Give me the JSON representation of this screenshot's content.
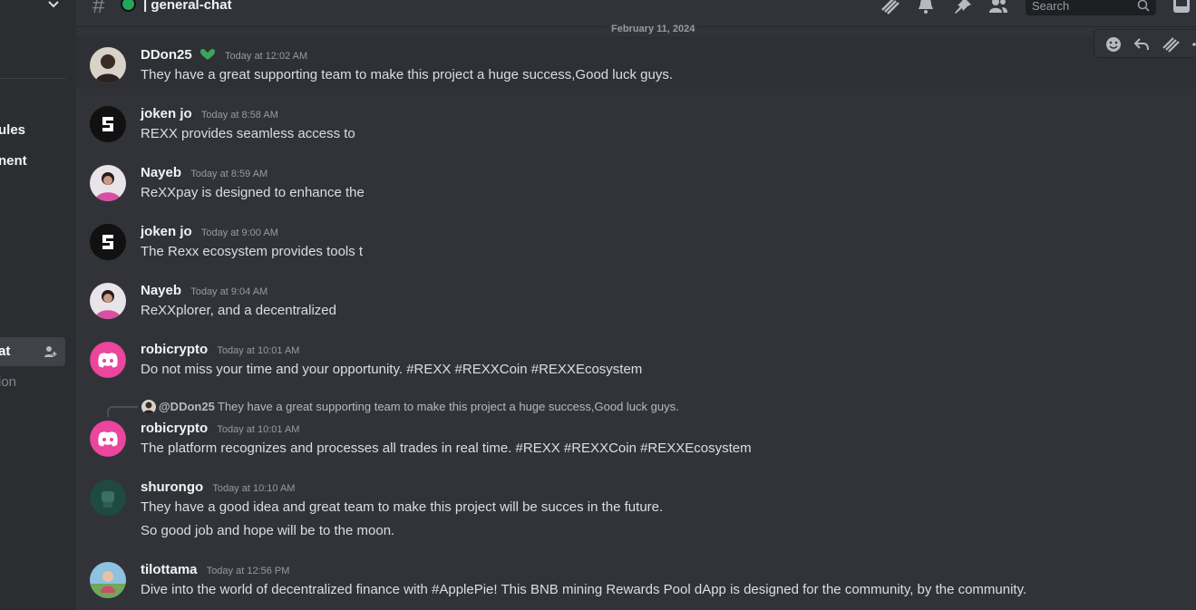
{
  "sidebar": {
    "channels": [
      {
        "label": "ules"
      },
      {
        "label": "nent"
      }
    ],
    "active_channel": {
      "label": "at"
    },
    "dim_channel": {
      "label": "ion"
    }
  },
  "topbar": {
    "channel_name": "| general-chat",
    "search_placeholder": "Search"
  },
  "date_separator": "February 11, 2024",
  "messages": [
    {
      "author": "DDon25",
      "timestamp": "Today at 12:02 AM",
      "lines": [
        "They have a great supporting team to make this project a huge success,Good luck guys."
      ]
    },
    {
      "author": "joken  jo",
      "timestamp": "Today at 8:58 AM",
      "lines": [
        "REXX provides seamless access to"
      ]
    },
    {
      "author": "Nayeb",
      "timestamp": "Today at 8:59 AM",
      "lines": [
        "ReXXpay is designed to enhance the"
      ]
    },
    {
      "author": "joken  jo",
      "timestamp": "Today at 9:00 AM",
      "lines": [
        "The Rexx ecosystem provides tools t"
      ]
    },
    {
      "author": "Nayeb",
      "timestamp": "Today at 9:04 AM",
      "lines": [
        "ReXXplorer, and a decentralized"
      ]
    },
    {
      "author": "robicrypto",
      "timestamp": "Today at 10:01 AM",
      "lines": [
        "Do not miss your time and your opportunity. #REXX #REXXCoin #REXXEcosystem"
      ]
    },
    {
      "author": "robicrypto",
      "timestamp": "Today at 10:01 AM",
      "lines": [
        "The platform recognizes and processes all trades in real time. #REXX #REXXCoin #REXXEcosystem"
      ],
      "reply": {
        "author": "@DDon25",
        "text": "They have a great supporting team to make this project a huge success,Good luck guys."
      }
    },
    {
      "author": "shurongo",
      "timestamp": "Today at 10:10 AM",
      "lines": [
        "They have a good idea and great team to make this project will be succes in the future.",
        "So good job and hope will be to the moon."
      ]
    },
    {
      "author": "tilottama",
      "timestamp": "Today at 12:56 PM",
      "lines": [
        "Dive into the world of decentralized finance with #ApplePie! This BNB mining Rewards Pool dApp is designed for the community, by the community."
      ]
    }
  ],
  "colors": {
    "background": "#313338",
    "sidebar": "#2b2d31",
    "online": "#23a55a",
    "discord_pink": "#eb459e"
  }
}
